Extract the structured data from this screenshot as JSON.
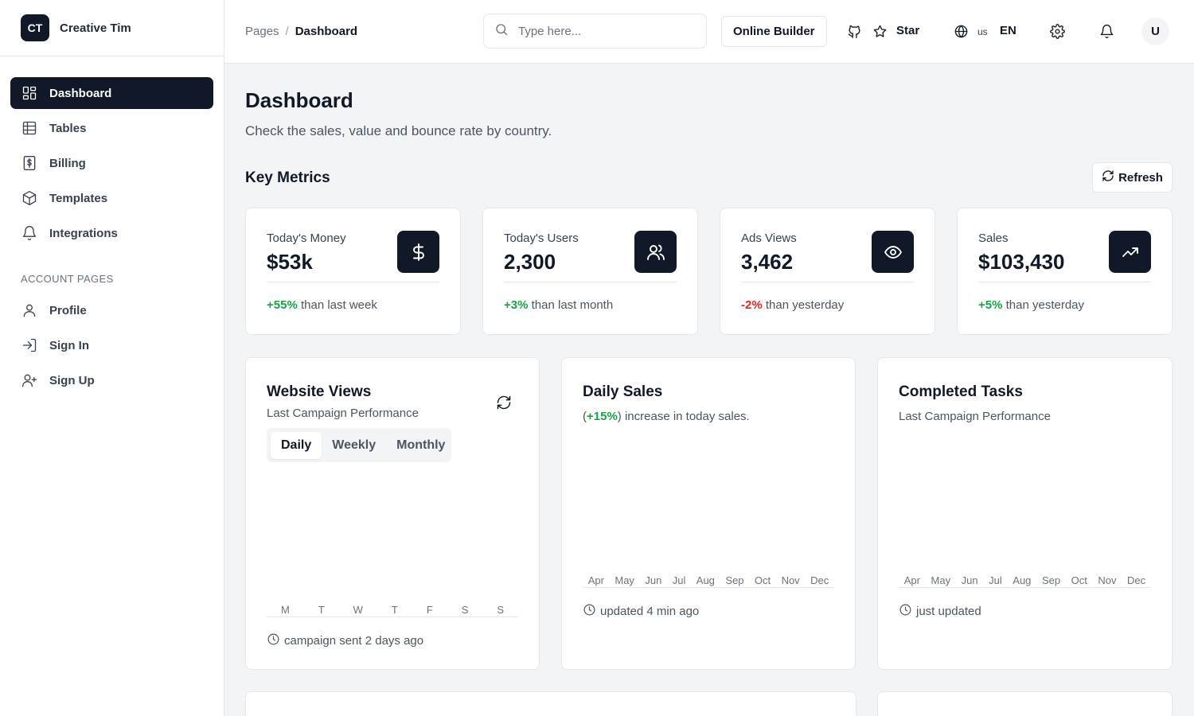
{
  "brand": {
    "logo": "CT",
    "name": "Creative Tim"
  },
  "sidebar": {
    "items": [
      {
        "label": "Dashboard",
        "icon": "dashboard-icon"
      },
      {
        "label": "Tables",
        "icon": "table-icon"
      },
      {
        "label": "Billing",
        "icon": "billing-icon"
      },
      {
        "label": "Templates",
        "icon": "cube-icon"
      },
      {
        "label": "Integrations",
        "icon": "bell-icon"
      }
    ],
    "section_label": "ACCOUNT PAGES",
    "account_items": [
      {
        "label": "Profile",
        "icon": "user-icon"
      },
      {
        "label": "Sign In",
        "icon": "sign-in-icon"
      },
      {
        "label": "Sign Up",
        "icon": "user-plus-icon"
      }
    ]
  },
  "topbar": {
    "breadcrumb": {
      "parent": "Pages",
      "separator": "/",
      "current": "Dashboard"
    },
    "search_placeholder": "Type here...",
    "builder_label": "Online Builder",
    "star_label": "Star",
    "lang_region": "us",
    "lang_code": "EN",
    "avatar_initial": "U"
  },
  "page": {
    "title": "Dashboard",
    "subtitle": "Check the sales, value and bounce rate by country.",
    "section_title": "Key Metrics",
    "refresh_label": "Refresh"
  },
  "metrics": [
    {
      "label": "Today's Money",
      "value": "$53k",
      "change": "+55%",
      "change_type": "positive",
      "suffix": " than last week",
      "icon": "dollar-icon"
    },
    {
      "label": "Today's Users",
      "value": "2,300",
      "change": "+3%",
      "change_type": "positive",
      "suffix": " than last month",
      "icon": "users-icon"
    },
    {
      "label": "Ads Views",
      "value": "3,462",
      "change": "-2%",
      "change_type": "negative",
      "suffix": " than yesterday",
      "icon": "eye-icon"
    },
    {
      "label": "Sales",
      "value": "$103,430",
      "change": "+5%",
      "change_type": "positive",
      "suffix": " than yesterday",
      "icon": "trending-up-icon"
    }
  ],
  "charts": [
    {
      "title": "Website Views",
      "subtitle": "Last Campaign Performance",
      "tabs": [
        "Daily",
        "Weekly",
        "Monthly"
      ],
      "active_tab": "Daily",
      "x_labels": [
        "M",
        "T",
        "W",
        "T",
        "F",
        "S",
        "S"
      ],
      "footer": "campaign sent 2 days ago"
    },
    {
      "title": "Daily Sales",
      "subtitle_prefix": "(",
      "subtitle_highlight": "+15%",
      "subtitle_suffix": ") increase in today sales.",
      "x_labels": [
        "Apr",
        "May",
        "Jun",
        "Jul",
        "Aug",
        "Sep",
        "Oct",
        "Nov",
        "Dec"
      ],
      "footer": "updated 4 min ago"
    },
    {
      "title": "Completed Tasks",
      "subtitle": "Last Campaign Performance",
      "x_labels": [
        "Apr",
        "May",
        "Jun",
        "Jul",
        "Aug",
        "Sep",
        "Oct",
        "Nov",
        "Dec"
      ],
      "footer": "just updated"
    }
  ],
  "colors": {
    "dark": "#111827",
    "positive": "#16a34a",
    "negative": "#dc2626",
    "background": "#f3f4f6"
  }
}
